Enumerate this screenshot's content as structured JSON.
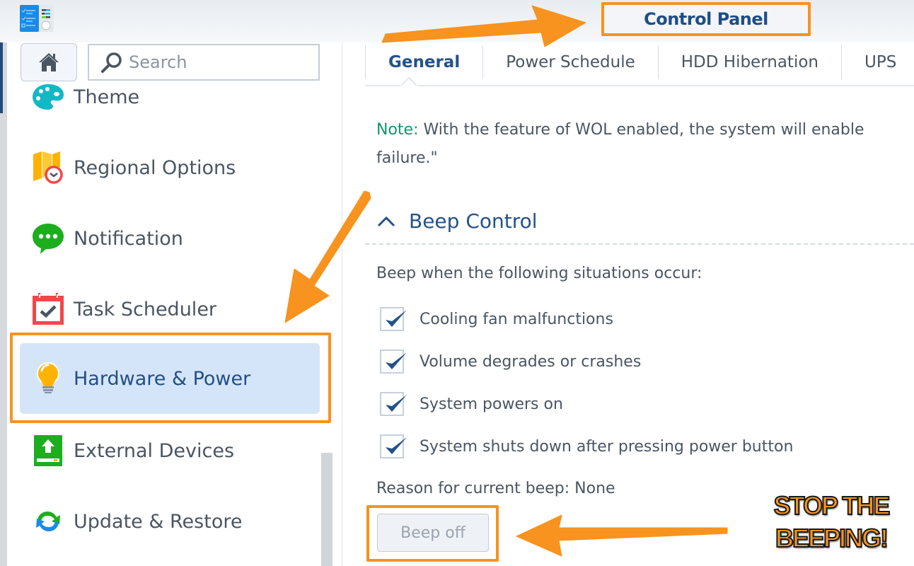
{
  "window": {
    "title": "Control Panel",
    "app_icon": "control-panel-icon"
  },
  "sidebar": {
    "home_icon": "home-icon",
    "search": {
      "placeholder": "Search",
      "value": "",
      "icon": "search-icon"
    },
    "items": [
      {
        "label": "Theme",
        "icon": "palette-icon",
        "active": false
      },
      {
        "label": "Regional Options",
        "icon": "map-clock-icon",
        "active": false
      },
      {
        "label": "Notification",
        "icon": "chat-bubble-icon",
        "active": false
      },
      {
        "label": "Task Scheduler",
        "icon": "calendar-check-icon",
        "active": false
      },
      {
        "label": "Hardware & Power",
        "icon": "lightbulb-icon",
        "active": true
      },
      {
        "label": "External Devices",
        "icon": "external-drive-icon",
        "active": false
      },
      {
        "label": "Update & Restore",
        "icon": "refresh-icon",
        "active": false
      }
    ]
  },
  "main": {
    "tabs": [
      {
        "label": "General",
        "active": true
      },
      {
        "label": "Power Schedule",
        "active": false
      },
      {
        "label": "HDD Hibernation",
        "active": false
      },
      {
        "label": "UPS",
        "active": false
      }
    ],
    "note": {
      "label": "Note:",
      "text": " With the feature of WOL enabled, the system will enable",
      "text_line2": "failure.\""
    },
    "beep_control": {
      "title": "Beep Control",
      "expanded": true,
      "description": "Beep when the following situations occur:",
      "options": [
        {
          "label": "Cooling fan malfunctions",
          "checked": true
        },
        {
          "label": "Volume degrades or crashes",
          "checked": true
        },
        {
          "label": "System powers on",
          "checked": true
        },
        {
          "label": "System shuts down after pressing power button",
          "checked": true
        }
      ],
      "reason": "Reason for current beep: None",
      "beep_off_label": "Beep off"
    }
  },
  "annotations": {
    "callout_line1": "STOP THE",
    "callout_line2": "BEEPING!",
    "accent_color": "#f7931e"
  },
  "colors": {
    "primary_blue": "#23528a",
    "note_green": "#13956f",
    "active_bg": "#d5e5f9",
    "text": "#4a5563"
  }
}
